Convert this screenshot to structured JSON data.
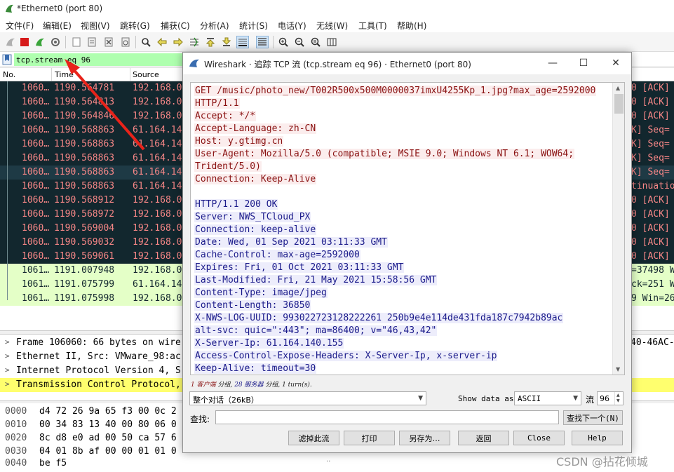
{
  "window": {
    "title": "*Ethernet0 (port 80)"
  },
  "menu": [
    "文件(F)",
    "编辑(E)",
    "视图(V)",
    "跳转(G)",
    "捕获(C)",
    "分析(A)",
    "统计(S)",
    "电话(Y)",
    "无线(W)",
    "工具(T)",
    "帮助(H)"
  ],
  "toolbar_icons": [
    "shark-fin-start-icon",
    "stop-capture-icon",
    "restart-capture-icon",
    "capture-options-icon",
    "open-file-icon",
    "save-file-icon",
    "close-file-icon",
    "reload-file-icon",
    "find-packet-icon",
    "go-back-icon",
    "go-forward-icon",
    "go-to-packet-icon",
    "go-first-icon",
    "go-last-icon",
    "autoscroll-icon",
    "colorize-icon",
    "zoom-in-icon",
    "zoom-out-icon",
    "zoom-normal-icon",
    "resize-columns-icon"
  ],
  "filter": {
    "value": "tcp.stream eq 96"
  },
  "packet_list": {
    "columns": [
      "No.",
      "Time",
      "Source"
    ],
    "rows": [
      {
        "no": "1060…",
        "time": "1190.564781",
        "src": "192.168.0…",
        "info": "0 [ACK]",
        "style": "dark"
      },
      {
        "no": "1060…",
        "time": "1190.564813",
        "src": "192.168.0…",
        "info": "0 [ACK]",
        "style": "dark"
      },
      {
        "no": "1060…",
        "time": "1190.564846",
        "src": "192.168.0…",
        "info": "0 [ACK]",
        "style": "dark"
      },
      {
        "no": "1060…",
        "time": "1190.568863",
        "src": "61.164.14…",
        "info": "K] Seq=",
        "style": "dark"
      },
      {
        "no": "1060…",
        "time": "1190.568863",
        "src": "61.164.14…",
        "info": "K] Seq=",
        "style": "dark"
      },
      {
        "no": "1060…",
        "time": "1190.568863",
        "src": "61.164.14…",
        "info": "K] Seq=",
        "style": "dark"
      },
      {
        "no": "1060…",
        "time": "1190.568863",
        "src": "61.164.14…",
        "info": "K] Seq=",
        "style": "sel"
      },
      {
        "no": "1060…",
        "time": "1190.568863",
        "src": "61.164.14…",
        "info": "tinuatio",
        "style": "dark"
      },
      {
        "no": "1060…",
        "time": "1190.568912",
        "src": "192.168.0…",
        "info": "0 [ACK]",
        "style": "dark"
      },
      {
        "no": "1060…",
        "time": "1190.568972",
        "src": "192.168.0…",
        "info": "0 [ACK]",
        "style": "dark"
      },
      {
        "no": "1060…",
        "time": "1190.569004",
        "src": "192.168.0…",
        "info": "0 [ACK]",
        "style": "dark"
      },
      {
        "no": "1060…",
        "time": "1190.569032",
        "src": "192.168.0…",
        "info": "0 [ACK]",
        "style": "dark"
      },
      {
        "no": "1060…",
        "time": "1190.569061",
        "src": "192.168.0…",
        "info": "0 [ACK]",
        "style": "dark"
      },
      {
        "no": "1061…",
        "time": "1191.007948",
        "src": "192.168.0…",
        "info": "=37498 W",
        "style": "light"
      },
      {
        "no": "1061…",
        "time": "1191.075799",
        "src": "61.164.14…",
        "info": "ck=251 W",
        "style": "light"
      },
      {
        "no": "1061…",
        "time": "1191.075998",
        "src": "192.168.0…",
        "info": "9 Win=26",
        "style": "light"
      }
    ]
  },
  "details": [
    {
      "text": "Frame 106060: 66 bytes on wire",
      "right": "40-46AC-9",
      "highlight": false
    },
    {
      "text": "Ethernet II, Src: VMware_98:ac",
      "right": "",
      "highlight": false
    },
    {
      "text": "Internet Protocol Version 4, S",
      "right": "",
      "highlight": false
    },
    {
      "text": "Transmission Control Protocol,",
      "right": "",
      "highlight": true
    }
  ],
  "bytes": [
    {
      "off": "0000",
      "hex": "d4 72 26 9a 65 f3 00 0c  2"
    },
    {
      "off": "0010",
      "hex": "00 34 83 13 40 00 80 06  0"
    },
    {
      "off": "0020",
      "hex": "8c d8 e0 ad 00 50 ca 57  6"
    },
    {
      "off": "0030",
      "hex": "04 01 8b af 00 00 01 01  0"
    },
    {
      "off": "0040",
      "hex": "be f5"
    }
  ],
  "bytes_dots": "··",
  "watermark": "CSDN @拈花倾城",
  "dialog": {
    "title": "Wireshark · 追踪 TCP 流 (tcp.stream eq 96) · Ethernet0 (port 80)",
    "client_lines": [
      "GET /music/photo_new/T002R500x500M0000037imxU4255Kp_1.jpg?max_age=2592000",
      "HTTP/1.1",
      "Accept: */*",
      "Accept-Language: zh-CN",
      "Host: y.gtimg.cn",
      "User-Agent: Mozilla/5.0 (compatible; MSIE 9.0; Windows NT 6.1; WOW64;",
      "Trident/5.0)",
      "Connection: Keep-Alive"
    ],
    "server_lines": [
      "HTTP/1.1 200 OK",
      "Server: NWS_TCloud_PX",
      "Connection: keep-alive",
      "Date: Wed, 01 Sep 2021 03:11:33 GMT",
      "Cache-Control: max-age=2592000",
      "Expires: Fri, 01 Oct 2021 03:11:33 GMT",
      "Last-Modified: Fri, 21 May 2021 15:58:56 GMT",
      "Content-Type: image/jpeg",
      "Content-Length: 36850",
      "X-NWS-LOG-UUID: 993022723128222261 250b9e4e114de431fda187c7942b89ac",
      "alt-svc: quic=\":443\"; ma=86400; v=\"46,43,42\"",
      "X-Server-Ip: 61.164.140.155",
      "Access-Control-Expose-Headers: X-Server-Ip, x-server-ip",
      "Keep-Alive: timeout=30"
    ],
    "summary": {
      "client": "1 客户端",
      "client_suffix": " 分组, ",
      "server": "28 服务器",
      "server_suffix": " 分组, 1 turn(s)."
    },
    "conversation_select": "整个对话（26kB）",
    "show_as_label": "Show data as",
    "show_as_value": "ASCII",
    "stream_label": "流",
    "stream_value": "96",
    "find_label": "查找:",
    "find_value": "",
    "find_next_label": "查找下一个(N)",
    "buttons": {
      "filter_out": "滤掉此流",
      "print": "打印",
      "save_as": "另存为…",
      "back": "返回",
      "close": "Close",
      "help": "Help"
    }
  },
  "colors": {
    "dark_row_bg": "#12272e",
    "dark_row_fg": "#f78787",
    "light_row_bg": "#e4ffc7",
    "filter_bg": "#afffaf",
    "client_fg": "#8a1212",
    "server_fg": "#1a1a8a",
    "highlight": "#ffff6e",
    "annotation_arrow": "#e8231a"
  }
}
